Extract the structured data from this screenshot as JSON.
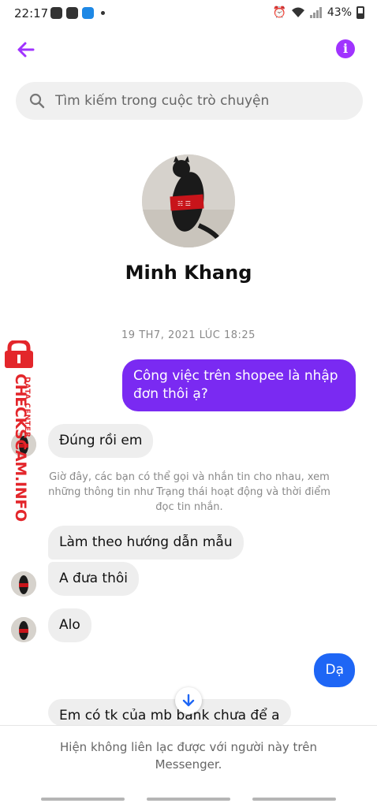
{
  "status_bar": {
    "time": "22:17",
    "battery": "43%"
  },
  "header": {
    "back_icon": "back-arrow-icon",
    "info_icon": "info-icon",
    "info_glyph": "i",
    "accent_color": "#a033ff"
  },
  "search": {
    "placeholder": "Tìm kiếm trong cuộc trò chuyện"
  },
  "profile": {
    "name": "Minh Khang"
  },
  "conversation": {
    "timestamp": "19 TH7, 2021 LÚC 18:25",
    "messages": [
      {
        "text": "Công việc trên shopee là nhập đơn thôi ạ?",
        "from": "me"
      },
      {
        "text": "Đúng rồi em",
        "from": "them"
      },
      {
        "text": "Làm theo hướng dẫn mẫu",
        "from": "them"
      },
      {
        "text": "A đưa thôi",
        "from": "them"
      },
      {
        "text": "Alo",
        "from": "them"
      },
      {
        "text": "Dạ",
        "from": "me"
      },
      {
        "text": "Em có tk của mb bank chưa để a",
        "from": "them"
      }
    ],
    "system_note": "Giờ đây, các bạn có thể gọi và nhắn tin cho nhau, xem những thông tin như Trạng thái hoạt động và thời điểm đọc tin nhắn."
  },
  "watermark": {
    "brand": "CHECKSCAM.INFO",
    "sub": "DATA CENTER"
  },
  "footer": {
    "notice": "Hiện không liên lạc được với người này trên Messenger."
  },
  "colors": {
    "outgoing_purple": "#7a2af2",
    "outgoing_blue": "#1e66f5",
    "incoming_gray": "#eeeeee",
    "watermark_red": "#e3262b"
  }
}
